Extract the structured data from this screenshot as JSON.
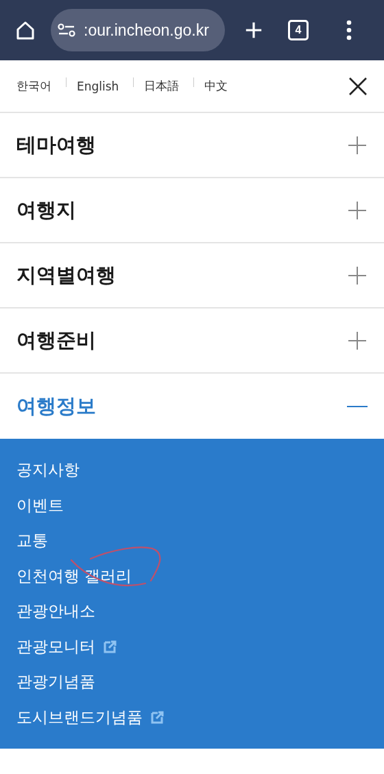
{
  "browser": {
    "url": ":our.incheon.go.kr",
    "tab_count": "4"
  },
  "languages": [
    {
      "label": "한국어"
    },
    {
      "label": "English"
    },
    {
      "label": "日本語"
    },
    {
      "label": "中文"
    }
  ],
  "menu": [
    {
      "label": "테마여행",
      "expanded": false
    },
    {
      "label": "여행지",
      "expanded": false
    },
    {
      "label": "지역별여행",
      "expanded": false
    },
    {
      "label": "여행준비",
      "expanded": false
    },
    {
      "label": "여행정보",
      "expanded": true,
      "children": [
        {
          "label": "공지사항",
          "external": false,
          "circled": false
        },
        {
          "label": "이벤트",
          "external": false,
          "circled": false
        },
        {
          "label": "교통",
          "external": false,
          "circled": false
        },
        {
          "label": "인천여행 갤러리",
          "external": false,
          "circled": true
        },
        {
          "label": "관광안내소",
          "external": false,
          "circled": false
        },
        {
          "label": "관광모니터",
          "external": true,
          "circled": false
        },
        {
          "label": "관광기념품",
          "external": false,
          "circled": false
        },
        {
          "label": "도시브랜드기념품",
          "external": true,
          "circled": false
        }
      ]
    }
  ]
}
